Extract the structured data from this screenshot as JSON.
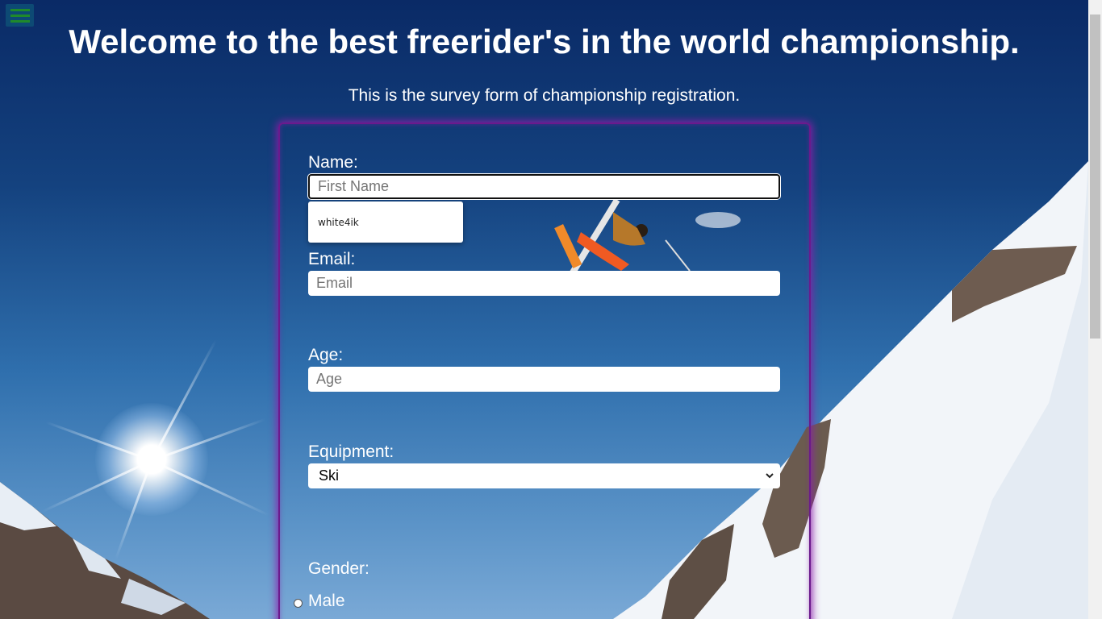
{
  "header": {
    "title": "Welcome to the best freerider's in the world championship.",
    "subtitle": "This is the survey form of championship registration."
  },
  "form": {
    "name": {
      "label": "Name:",
      "placeholder": "First Name",
      "value": ""
    },
    "autofill_suggestion": "white4ik",
    "email": {
      "label": "Email:",
      "placeholder": "Email",
      "value": ""
    },
    "age": {
      "label": "Age:",
      "placeholder": "Age",
      "value": ""
    },
    "equipment": {
      "label": "Equipment:",
      "selected": "Ski"
    },
    "gender": {
      "label": "Gender:",
      "options": [
        "Male"
      ]
    }
  },
  "icons": {
    "menu": "hamburger-menu-icon",
    "select": "chevron-down-icon"
  },
  "colors": {
    "form_border": "#6b1a8c",
    "menu_bar": "#1f8a2b",
    "menu_bg": "#0d4a74",
    "text": "#ffffff"
  }
}
